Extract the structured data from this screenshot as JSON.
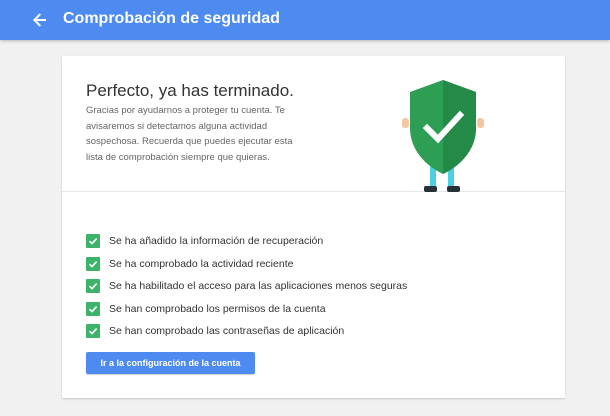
{
  "header": {
    "title": "Comprobación de seguridad",
    "back_icon": "arrow-back-icon",
    "background_color": "#4e8bf0"
  },
  "card": {
    "heading": "Perfecto, ya has terminado.",
    "description": "Gracias por ayudarnos a proteger tu cuenta. Te avisaremos si detectamos alguna actividad sospechosa. Recuerda que puedes ejecutar esta lista de comprobación siempre que quieras.",
    "illustration_icon": "shield-check-icon",
    "checklist": [
      {
        "label": "Se ha añadido la información de recuperación",
        "checked": true
      },
      {
        "label": "Se ha comprobado la actividad reciente",
        "checked": true
      },
      {
        "label": "Se ha habilitado el acceso para las aplicaciones menos seguras",
        "checked": true
      },
      {
        "label": "Se han comprobado los permisos de la cuenta",
        "checked": true
      },
      {
        "label": "Se han comprobado las contraseñas de aplicación",
        "checked": true
      }
    ],
    "check_color": "#3db36a",
    "button_label": "Ir a la configuración de la cuenta"
  }
}
